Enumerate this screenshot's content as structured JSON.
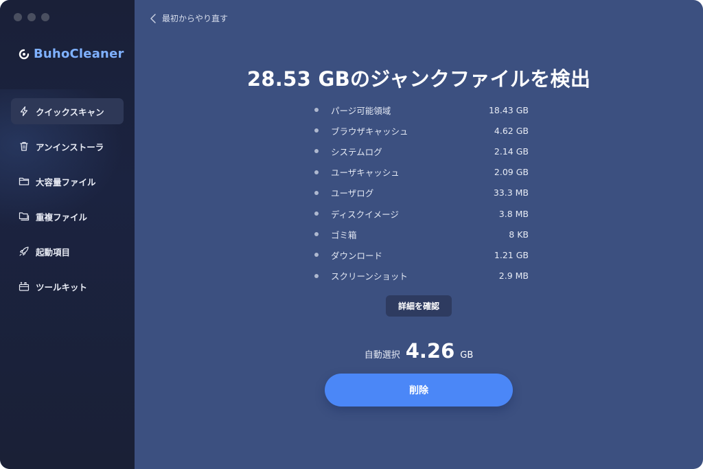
{
  "app": {
    "name": "BuhoCleaner",
    "brand_color": "#7fb1ff"
  },
  "sidebar": {
    "items": [
      {
        "label": "クイックスキャン",
        "icon": "lightning-icon",
        "active": true
      },
      {
        "label": "アンインストーラ",
        "icon": "trash-icon",
        "active": false
      },
      {
        "label": "大容量ファイル",
        "icon": "folder-icon",
        "active": false
      },
      {
        "label": "重複ファイル",
        "icon": "duplicate-folder-icon",
        "active": false
      },
      {
        "label": "起動項目",
        "icon": "rocket-icon",
        "active": false
      },
      {
        "label": "ツールキット",
        "icon": "toolkit-icon",
        "active": false
      }
    ]
  },
  "header": {
    "back_label": "最初からやり直す"
  },
  "result": {
    "total_size": "28.53",
    "total_unit": "GB",
    "headline_suffix": "のジャンクファイルを検出",
    "items": [
      {
        "label": "パージ可能領域",
        "size": "18.43 GB"
      },
      {
        "label": "ブラウザキャッシュ",
        "size": "4.62 GB"
      },
      {
        "label": "システムログ",
        "size": "2.14 GB"
      },
      {
        "label": "ユーザキャッシュ",
        "size": "2.09 GB"
      },
      {
        "label": "ユーザログ",
        "size": "33.3 MB"
      },
      {
        "label": "ディスクイメージ",
        "size": "3.8 MB"
      },
      {
        "label": "ゴミ箱",
        "size": "8 KB"
      },
      {
        "label": "ダウンロード",
        "size": "1.21 GB"
      },
      {
        "label": "スクリーンショット",
        "size": "2.9 MB"
      }
    ],
    "detail_button": "詳細を確認",
    "auto_select_label": "自動選択",
    "auto_select_amount": "4.26",
    "auto_select_unit": "GB",
    "delete_button": "削除"
  },
  "colors": {
    "main_bg": "#3c5080",
    "sidebar_bg": "#1a2038",
    "accent": "#4b87f7",
    "detail_button_bg": "#2e3b60"
  }
}
